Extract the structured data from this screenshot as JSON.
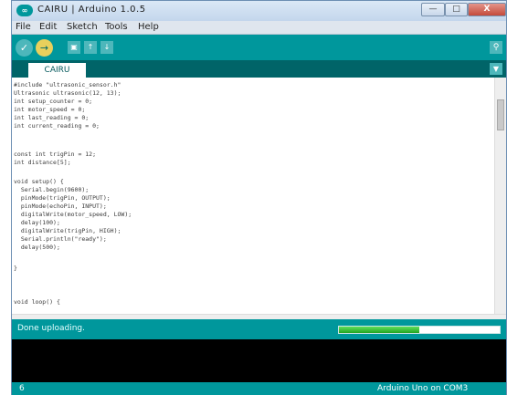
{
  "window": {
    "title": "CAIRU | Arduino 1.0.5",
    "controls": {
      "minimize": "—",
      "maximize": "□",
      "close": "X"
    }
  },
  "menu": {
    "items": [
      "File",
      "Edit",
      "Sketch",
      "Tools",
      "Help"
    ]
  },
  "toolbar": {
    "verify_icon": "✓",
    "upload_icon": "→",
    "new_icon": "▣",
    "open_icon": "↑",
    "save_icon": "↓",
    "serial_icon": "⚲"
  },
  "tabs": {
    "active": "CAIRU",
    "menu_icon": "▼"
  },
  "code": {
    "lines": [
      "#include \"ultrasonic_sensor.h\"",
      "Ultrasonic ultrasonic(12, 13);",
      "int setup_counter = 0;",
      "int motor_speed = 0;",
      "int last_reading = 0;",
      "int current_reading = 0;",
      "",
      "const int trigPin = 12;",
      "int distance[5];",
      "",
      "void setup() {",
      "  Serial.begin(9600);",
      "  pinMode(trigPin, OUTPUT);",
      "  pinMode(echoPin, INPUT);",
      "  digitalWrite(motor_speed, LOW);",
      "  delay(100);",
      "  digitalWrite(trigPin, HIGH);",
      "  Serial.println(\"ready\");",
      "  delay(500);",
      "}",
      "",
      "void loop() {"
    ]
  },
  "status": {
    "message": "Done uploading.",
    "progress": 0.5
  },
  "footer": {
    "line_number": "6",
    "board": "Arduino Uno on COM3"
  }
}
